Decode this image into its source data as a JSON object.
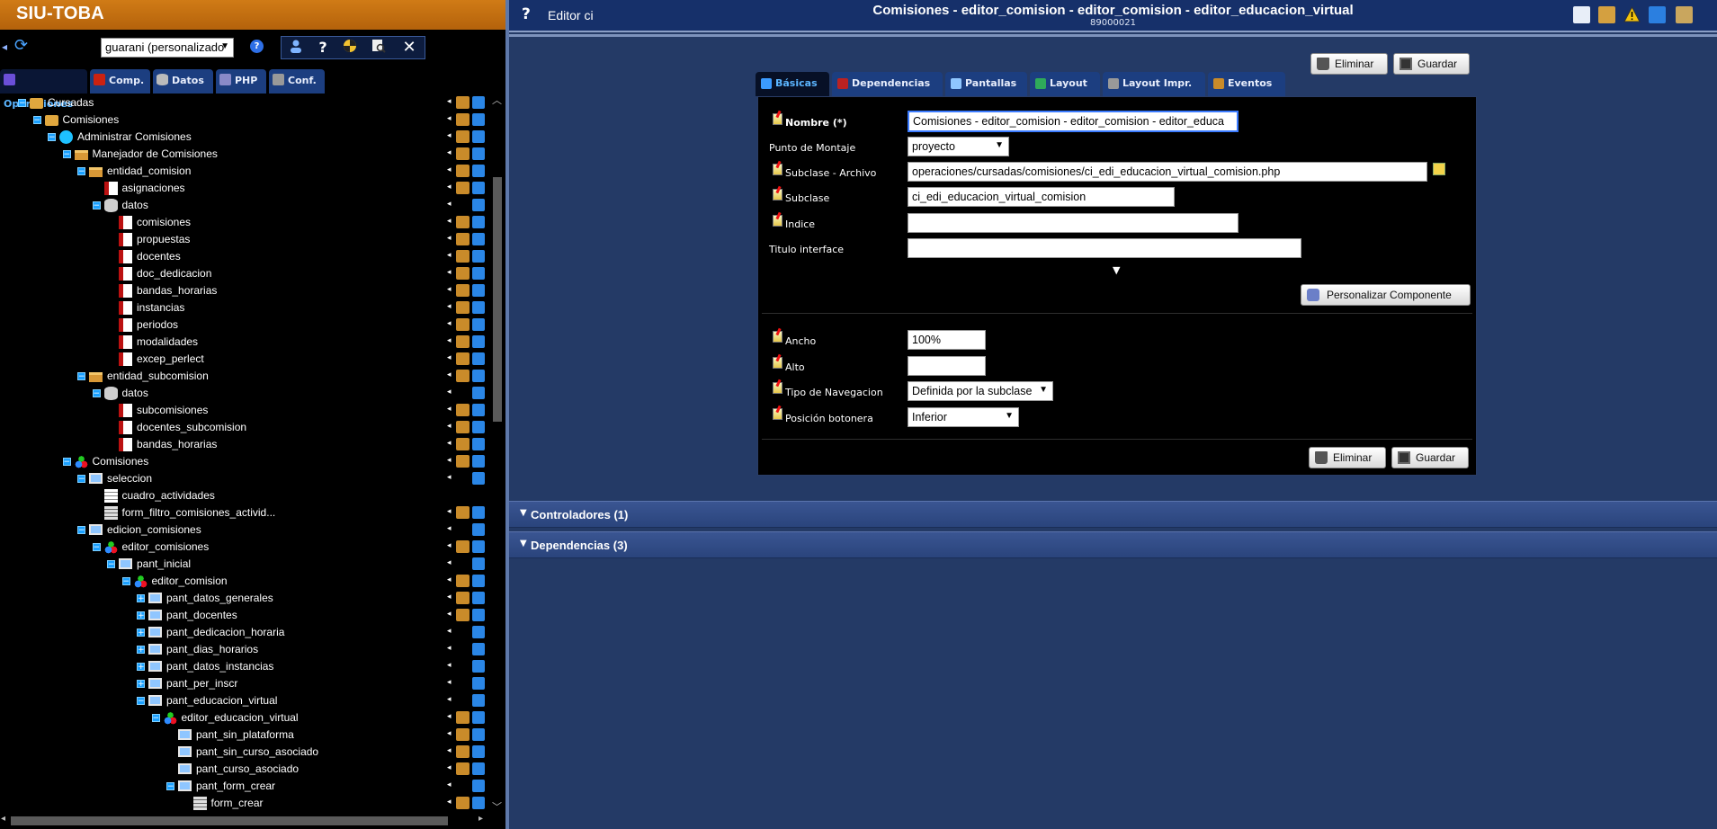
{
  "app": {
    "brand": "SIU-TOBA"
  },
  "left_toolbar": {
    "project_select": "guarani (personalizado",
    "buttons": [
      "user-icon",
      "help-icon",
      "debug-icon",
      "inspect-icon",
      "close-icon"
    ]
  },
  "left_tabs": [
    {
      "label": "Operaciones",
      "active": true,
      "icon": "operations-icon"
    },
    {
      "label": "Comp.",
      "active": false,
      "icon": "components-icon"
    },
    {
      "label": "Datos",
      "active": false,
      "icon": "database-icon"
    },
    {
      "label": "PHP",
      "active": false,
      "icon": "php-icon"
    },
    {
      "label": "Conf.",
      "active": false,
      "icon": "wrench-icon"
    }
  ],
  "tree": [
    {
      "label": "Cursadas",
      "level": 0,
      "icon": "folder",
      "toggle": "-",
      "actions": "full"
    },
    {
      "label": "Comisiones",
      "level": 1,
      "icon": "folder",
      "toggle": "-",
      "actions": "full"
    },
    {
      "label": "Administrar Comisiones",
      "level": 2,
      "icon": "gear",
      "toggle": "-",
      "actions": "full"
    },
    {
      "label": "Manejador de Comisiones",
      "level": 3,
      "icon": "case",
      "toggle": "-",
      "actions": "full"
    },
    {
      "label": "entidad_comision",
      "level": 4,
      "icon": "case",
      "toggle": "-",
      "actions": "full"
    },
    {
      "label": "asignaciones",
      "level": 5,
      "icon": "table",
      "toggle": "",
      "actions": "full"
    },
    {
      "label": "datos",
      "level": 5,
      "icon": "db",
      "toggle": "-",
      "actions": "short"
    },
    {
      "label": "comisiones",
      "level": 6,
      "icon": "table",
      "toggle": "",
      "actions": "full"
    },
    {
      "label": "propuestas",
      "level": 6,
      "icon": "table",
      "toggle": "",
      "actions": "full"
    },
    {
      "label": "docentes",
      "level": 6,
      "icon": "table",
      "toggle": "",
      "actions": "full"
    },
    {
      "label": "doc_dedicacion",
      "level": 6,
      "icon": "table",
      "toggle": "",
      "actions": "full"
    },
    {
      "label": "bandas_horarias",
      "level": 6,
      "icon": "table",
      "toggle": "",
      "actions": "full"
    },
    {
      "label": "instancias",
      "level": 6,
      "icon": "table",
      "toggle": "",
      "actions": "full"
    },
    {
      "label": "periodos",
      "level": 6,
      "icon": "table",
      "toggle": "",
      "actions": "full"
    },
    {
      "label": "modalidades",
      "level": 6,
      "icon": "table",
      "toggle": "",
      "actions": "full"
    },
    {
      "label": "excep_perlect",
      "level": 6,
      "icon": "table",
      "toggle": "",
      "actions": "full"
    },
    {
      "label": "entidad_subcomision",
      "level": 4,
      "icon": "case",
      "toggle": "-",
      "actions": "full"
    },
    {
      "label": "datos",
      "level": 5,
      "icon": "db",
      "toggle": "-",
      "actions": "short"
    },
    {
      "label": "subcomisiones",
      "level": 6,
      "icon": "table",
      "toggle": "",
      "actions": "full"
    },
    {
      "label": "docentes_subcomision",
      "level": 6,
      "icon": "table",
      "toggle": "",
      "actions": "full"
    },
    {
      "label": "bandas_horarias",
      "level": 6,
      "icon": "table",
      "toggle": "",
      "actions": "full"
    },
    {
      "label": "Comisiones",
      "level": 3,
      "icon": "ci",
      "toggle": "-",
      "actions": "full"
    },
    {
      "label": "seleccion",
      "level": 4,
      "icon": "screen",
      "toggle": "-",
      "actions": "short"
    },
    {
      "label": "cuadro_actividades",
      "level": 5,
      "icon": "grid",
      "toggle": "",
      "actions": "none"
    },
    {
      "label": "form_filtro_comisiones_activid...",
      "level": 5,
      "icon": "form",
      "toggle": "",
      "actions": "full"
    },
    {
      "label": "edicion_comisiones",
      "level": 4,
      "icon": "screen",
      "toggle": "-",
      "actions": "short"
    },
    {
      "label": "editor_comisiones",
      "level": 5,
      "icon": "ci",
      "toggle": "-",
      "actions": "full"
    },
    {
      "label": "pant_inicial",
      "level": 6,
      "icon": "screen",
      "toggle": "-",
      "actions": "short"
    },
    {
      "label": "editor_comision",
      "level": 7,
      "icon": "ci",
      "toggle": "-",
      "actions": "full"
    },
    {
      "label": "pant_datos_generales",
      "level": 8,
      "icon": "screen",
      "toggle": "+",
      "actions": "full"
    },
    {
      "label": "pant_docentes",
      "level": 8,
      "icon": "screen",
      "toggle": "+",
      "actions": "full"
    },
    {
      "label": "pant_dedicacion_horaria",
      "level": 8,
      "icon": "screen",
      "toggle": "+",
      "actions": "short"
    },
    {
      "label": "pant_dias_horarios",
      "level": 8,
      "icon": "screen",
      "toggle": "+",
      "actions": "short"
    },
    {
      "label": "pant_datos_instancias",
      "level": 8,
      "icon": "screen",
      "toggle": "+",
      "actions": "short"
    },
    {
      "label": "pant_per_inscr",
      "level": 8,
      "icon": "screen",
      "toggle": "+",
      "actions": "short"
    },
    {
      "label": "pant_educacion_virtual",
      "level": 8,
      "icon": "screen",
      "toggle": "-",
      "actions": "short"
    },
    {
      "label": "editor_educacion_virtual",
      "level": 9,
      "icon": "ci",
      "toggle": "-",
      "actions": "full"
    },
    {
      "label": "pant_sin_plataforma",
      "level": 10,
      "icon": "screen",
      "toggle": "",
      "actions": "full"
    },
    {
      "label": "pant_sin_curso_asociado",
      "level": 10,
      "icon": "screen",
      "toggle": "",
      "actions": "full"
    },
    {
      "label": "pant_curso_asociado",
      "level": 10,
      "icon": "screen",
      "toggle": "",
      "actions": "full"
    },
    {
      "label": "pant_form_crear",
      "level": 10,
      "icon": "screen",
      "toggle": "-",
      "actions": "short"
    },
    {
      "label": "form_crear",
      "level": 11,
      "icon": "form",
      "toggle": "",
      "actions": "full"
    }
  ],
  "header": {
    "help": "?",
    "editor_title": "Editor ci",
    "main_title": "Comisiones - editor_comision - editor_comision - editor_educacion_virtual",
    "object_id": "89000021",
    "tools": [
      "document-icon",
      "edit-icon",
      "warning-icon",
      "layout-icon",
      "export-icon"
    ]
  },
  "actions": {
    "delete_label": "Eliminar",
    "save_label": "Guardar"
  },
  "form_tabs": [
    {
      "label": "Básicas",
      "active": true,
      "icon": "basic-icon"
    },
    {
      "label": "Dependencias",
      "active": false,
      "icon": "dependencies-icon"
    },
    {
      "label": "Pantallas",
      "active": false,
      "icon": "screens-icon"
    },
    {
      "label": "Layout",
      "active": false,
      "icon": "layout-icon"
    },
    {
      "label": "Layout Impr.",
      "active": false,
      "icon": "print-layout-icon"
    },
    {
      "label": "Eventos",
      "active": false,
      "icon": "events-icon"
    }
  ],
  "form": {
    "nombre": {
      "label": "Nombre (*)",
      "value": "Comisiones - editor_comision - editor_comision - editor_educa"
    },
    "punto_montaje": {
      "label": "Punto de Montaje",
      "value": "proyecto"
    },
    "subclase_archivo": {
      "label": "Subclase - Archivo",
      "value": "operaciones/cursadas/comisiones/ci_edi_educacion_virtual_comision.php"
    },
    "subclase": {
      "label": "Subclase",
      "value": "ci_edi_educacion_virtual_comision"
    },
    "indice": {
      "label": "Indice",
      "value": ""
    },
    "titulo_interface": {
      "label": "Titulo interface",
      "value": ""
    },
    "personalizar_label": "Personalizar Componente",
    "ancho": {
      "label": "Ancho",
      "value": "100%"
    },
    "alto": {
      "label": "Alto",
      "value": ""
    },
    "tipo_navegacion": {
      "label": "Tipo de Navegacion",
      "value": "Definida por la subclase"
    },
    "posicion_botonera": {
      "label": "Posición botonera",
      "value": "Inferior"
    }
  },
  "sections": [
    {
      "label": "Controladores (1)"
    },
    {
      "label": "Dependencias (3)"
    }
  ]
}
